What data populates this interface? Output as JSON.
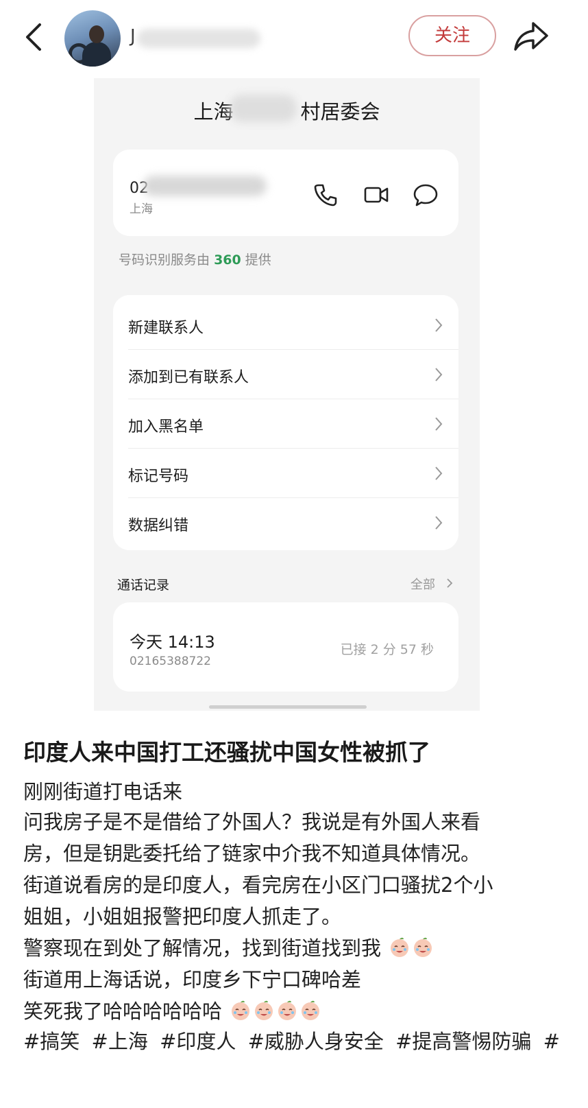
{
  "header": {
    "username_visible": "J",
    "follow_label": "关注"
  },
  "screenshot": {
    "title_left": "上海",
    "title_right": "村居委会",
    "number_prefix": "02",
    "location": "上海",
    "provider_prefix": "号码识别服务由",
    "provider_brand": "360",
    "provider_suffix": "提供",
    "menu": [
      {
        "label": "新建联系人"
      },
      {
        "label": "添加到已有联系人"
      },
      {
        "label": "加入黑名单"
      },
      {
        "label": "标记号码"
      },
      {
        "label": "数据纠错"
      }
    ],
    "calls_title": "通话记录",
    "calls_all": "全部",
    "call": {
      "time": "今天 14:13",
      "number": "02165388722",
      "duration": "已接 2 分 57 秒"
    }
  },
  "post": {
    "title": "印度人来中国打工还骚扰中国女性被抓了",
    "lines": [
      "刚刚街道打电话来",
      "问我房子是不是借给了外国人？我说是有外国人来看",
      "房，但是钥匙委托给了链家中介我不知道具体情况。",
      "街道说看房的是印度人，看完房在小区门口骚扰2个小",
      "姐姐，小姐姐报警把印度人抓走了。",
      "警察现在到处了解情况，找到街道找到我",
      "街道用上海话说，印度乡下宁口碑哈差",
      "笑死我了哈哈哈哈哈哈"
    ],
    "hashtags": [
      "#搞笑",
      "#上海",
      "#印度人",
      "#威胁人身安全",
      "#提高警惕防骗",
      "#"
    ]
  },
  "icons": {
    "back": "chevron-left-icon",
    "share": "share-arrow-icon",
    "phone": "phone-icon",
    "video": "video-camera-icon",
    "message": "chat-bubble-icon",
    "emoji": "crying-laughing-peach-emoji"
  },
  "colors": {
    "follow": "#c33a3a",
    "brand360": "#2e9b57"
  }
}
